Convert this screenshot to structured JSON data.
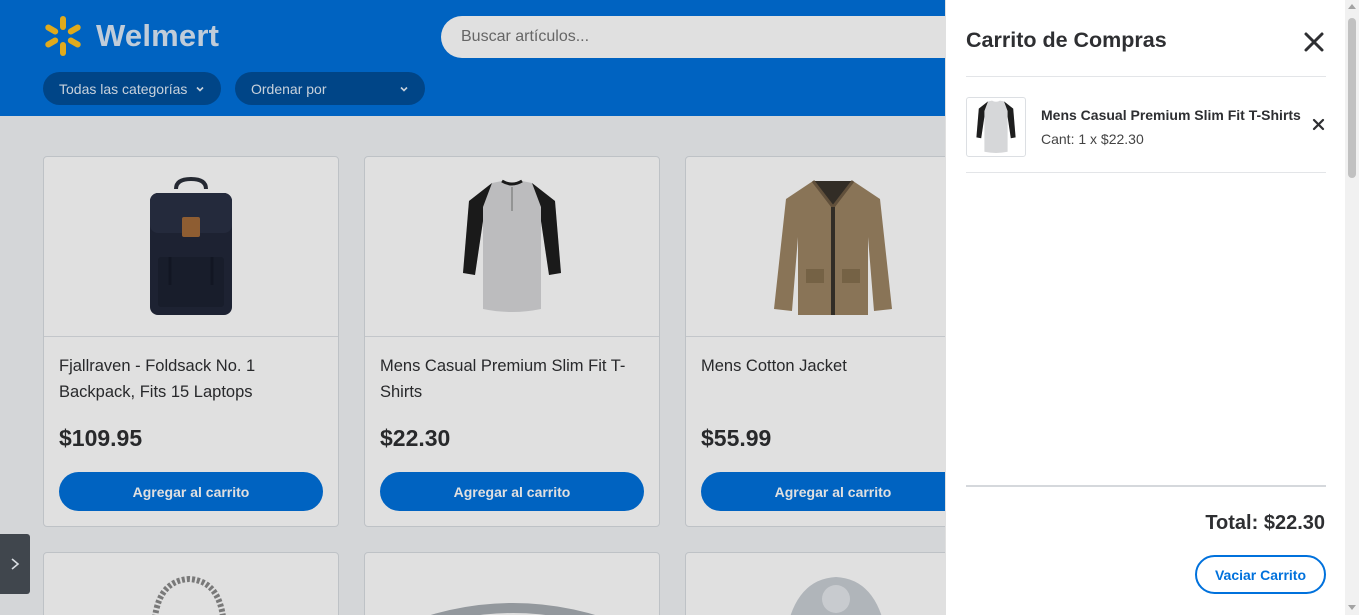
{
  "header": {
    "brand": "Welmert",
    "search_placeholder": "Buscar artículos...",
    "category_select": "Todas las categorías",
    "sort_select": "Ordenar por"
  },
  "products": [
    {
      "title": "Fjallraven - Foldsack No. 1 Backpack, Fits 15 Laptops",
      "price": "$109.95",
      "button": "Agregar al carrito",
      "icon": "backpack-image"
    },
    {
      "title": "Mens Casual Premium Slim Fit T-Shirts",
      "price": "$22.30",
      "button": "Agregar al carrito",
      "icon": "tshirt-image"
    },
    {
      "title": "Mens Cotton Jacket",
      "price": "$55.99",
      "button": "Agregar al carrito",
      "icon": "jacket-image"
    }
  ],
  "cart": {
    "title": "Carrito de Compras",
    "items": [
      {
        "name": "Mens Casual Premium Slim Fit T-Shirts",
        "qty_text": "Cant: 1 x $22.30"
      }
    ],
    "total": "Total: $22.30",
    "empty_button": "Vaciar Carrito"
  },
  "colors": {
    "brand_blue": "#0071dc",
    "logo_spark": "#ffc220"
  }
}
